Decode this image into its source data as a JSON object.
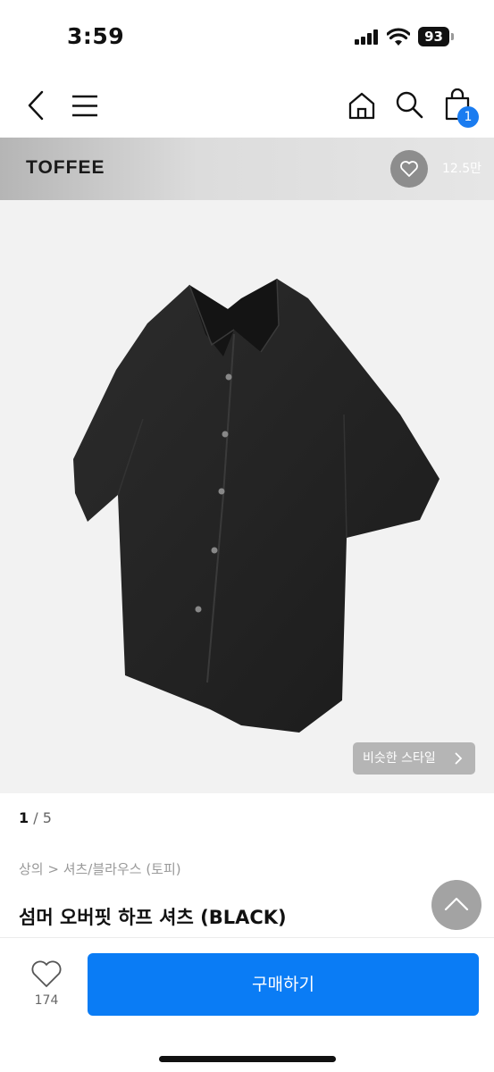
{
  "status_bar": {
    "time": "3:59",
    "battery": "93"
  },
  "nav": {
    "cart_count": "1"
  },
  "brand": {
    "name": "TOFFEE",
    "like_count": "12.5만"
  },
  "product": {
    "similar_style_label": "비슷한 스타일",
    "pager_current": "1",
    "pager_separator": " / ",
    "pager_total": "5",
    "breadcrumb": "상의 > 셔츠/블라우스 (토피)",
    "title": "섬머 오버핏 하프 셔츠 (BLACK)"
  },
  "bottom": {
    "like_count": "174",
    "buy_label": "구매하기"
  },
  "colors": {
    "accent": "#0a7cf5",
    "badge": "#1a7cf0"
  }
}
